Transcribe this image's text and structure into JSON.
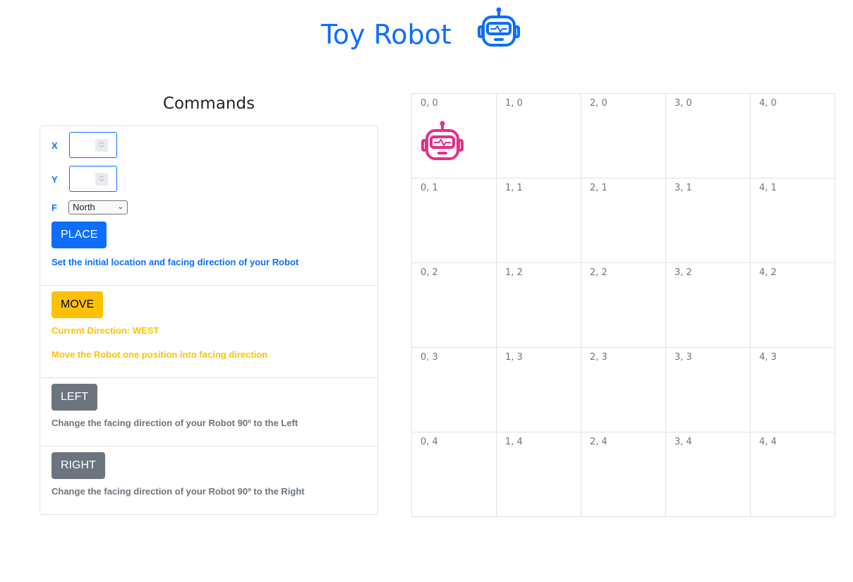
{
  "header": {
    "title": "Toy Robot",
    "logo_icon": "robot-icon",
    "accent_color": "#0d6efd"
  },
  "commands": {
    "title": "Commands",
    "place": {
      "x_label": "X",
      "y_label": "Y",
      "f_label": "F",
      "x_value": "",
      "y_value": "",
      "facing_options": [
        "North"
      ],
      "facing_selected": "North",
      "button_label": "PLACE",
      "help_text": "Set the initial location and facing direction of your Robot"
    },
    "move": {
      "button_label": "MOVE",
      "current_direction": "Current Direction: WEST",
      "help_text": "Move the Robot one position into facing direction"
    },
    "left": {
      "button_label": "LEFT",
      "help_text": "Change the facing direction of your Robot 90º to the Left"
    },
    "right": {
      "button_label": "RIGHT",
      "help_text": "Change the facing direction of your Robot 90º to the Right"
    }
  },
  "board": {
    "cells": [
      "0, 0",
      "1, 0",
      "2, 0",
      "3, 0",
      "4, 0",
      "0, 1",
      "1, 1",
      "2, 1",
      "3, 1",
      "4, 1",
      "0, 2",
      "1, 2",
      "2, 2",
      "3, 2",
      "4, 2",
      "0, 3",
      "1, 3",
      "2, 3",
      "3, 3",
      "4, 3",
      "0, 4",
      "1, 4",
      "2, 4",
      "3, 4",
      "4, 4"
    ],
    "robot_cell": "0, 0",
    "robot_icon": "robot-icon",
    "robot_color": "#e62e8a"
  }
}
